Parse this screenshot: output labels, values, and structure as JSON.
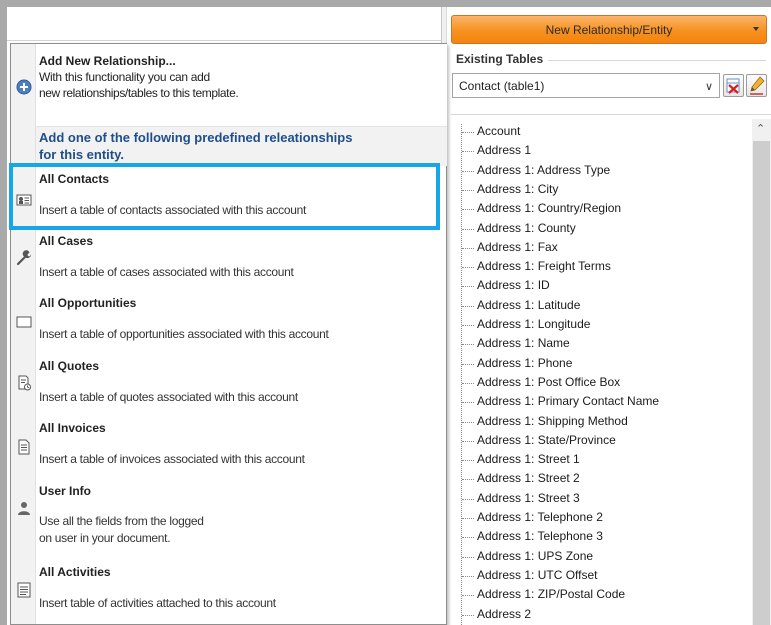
{
  "new_button": {
    "label": "New Relationship/Entity"
  },
  "existing_tables": {
    "label": "Existing Tables",
    "selected": "Contact  (table1)"
  },
  "menu": {
    "header_title": "Add New Relationship...",
    "header_desc_line1": "With this functionality you can add",
    "header_desc_line2": "new relationships/tables to this template.",
    "predefined_heading": "Add one of the following predefined releationships for this entity.",
    "items": [
      {
        "title": "All Contacts",
        "desc": "Insert a table of contacts associated with this account",
        "icon": "contact-card-icon"
      },
      {
        "title": "All Cases",
        "desc": "Insert a table of cases associated with this account",
        "icon": "wrench-icon"
      },
      {
        "title": "All Opportunities",
        "desc": "Insert a table of opportunities associated with this account",
        "icon": "window-icon"
      },
      {
        "title": "All Quotes",
        "desc": "Insert a table of quotes associated with this account",
        "icon": "quote-doc-icon"
      },
      {
        "title": "All Invoices",
        "desc": "Insert a table of invoices associated with this account",
        "icon": "invoice-doc-icon"
      },
      {
        "title": "User Info",
        "desc1": "Use all the fields from the logged",
        "desc2": "on user in your document.",
        "icon": "user-icon"
      },
      {
        "title": "All Activities",
        "desc": "Insert table of activities attached to this account",
        "icon": "activities-doc-icon"
      }
    ]
  },
  "tree": {
    "items": [
      "Account",
      "Address 1",
      "Address 1: Address Type",
      "Address 1: City",
      "Address 1: Country/Region",
      "Address 1: County",
      "Address 1: Fax",
      "Address 1: Freight Terms",
      "Address 1: ID",
      "Address 1: Latitude",
      "Address 1: Longitude",
      "Address 1: Name",
      "Address 1: Phone",
      "Address 1: Post Office Box",
      "Address 1: Primary Contact Name",
      "Address 1: Shipping Method",
      "Address 1: State/Province",
      "Address 1: Street 1",
      "Address 1: Street 2",
      "Address 1: Street 3",
      "Address 1: Telephone 2",
      "Address 1: Telephone 3",
      "Address 1: UPS Zone",
      "Address 1: UTC Offset",
      "Address 1: ZIP/Postal Code",
      "Address 2"
    ]
  }
}
